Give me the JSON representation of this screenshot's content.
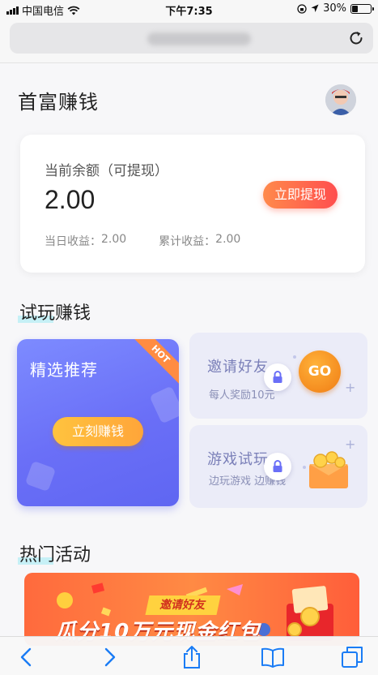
{
  "status_bar": {
    "carrier": "中国电信",
    "time": "下午7:35",
    "battery_percent": "30%",
    "battery_level": 0.3
  },
  "header": {
    "title": "首富赚钱"
  },
  "balance_card": {
    "label": "当前余额（可提现）",
    "value": "2.00",
    "withdraw_label": "立即提现",
    "today_label": "当日收益：",
    "today_value": "2.00",
    "total_label": "累计收益：",
    "total_value": "2.00"
  },
  "trial_section": {
    "title": "试玩赚钱",
    "recommend": {
      "title": "精选推荐",
      "badge": "HOT",
      "button": "立刻赚钱"
    },
    "invite": {
      "title": "邀请好友",
      "subtitle": "每人奖励10元",
      "go_label": "GO"
    },
    "game": {
      "title": "游戏试玩",
      "subtitle": "边玩游戏 边赚钱"
    }
  },
  "activity_section": {
    "title": "热门活动",
    "banner": {
      "tag": "邀请好友",
      "headline": "瓜分10万元现金红包"
    }
  },
  "colors": {
    "accent_orange": "#ff5a4a",
    "card_purple": "#6a6ff7",
    "button_yellow": "#ffb23a"
  },
  "icons": [
    "wifi-icon",
    "battery-icon",
    "reload-icon",
    "lock-icon",
    "back-icon",
    "forward-icon",
    "share-icon",
    "bookmarks-icon",
    "tabs-icon"
  ]
}
